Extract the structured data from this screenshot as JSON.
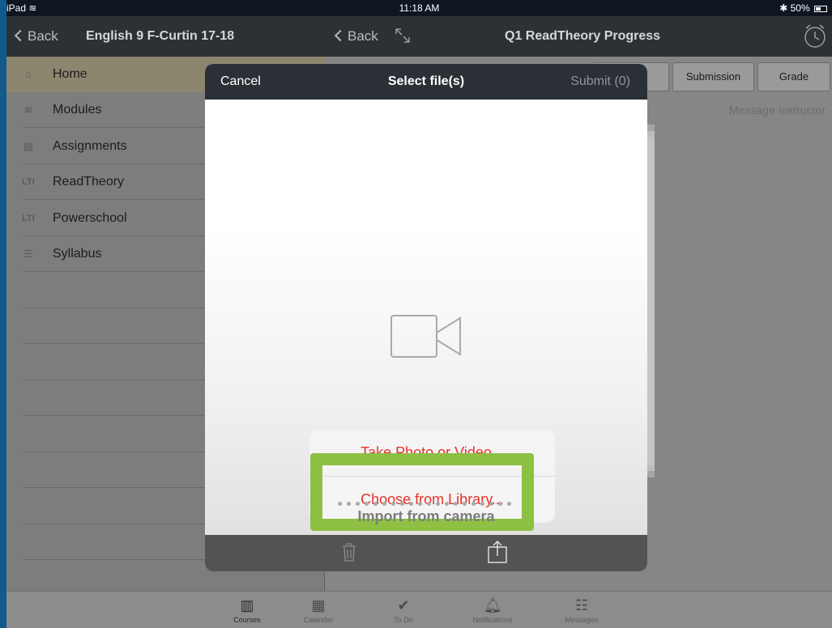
{
  "status_bar": {
    "device": "iPad",
    "time": "11:18 AM",
    "battery": "50%"
  },
  "nav_left": {
    "back_label": "Back",
    "title": "English 9 F-Curtin 17-18"
  },
  "nav_right": {
    "back_label": "Back",
    "title": "Q1 ReadTheory Progress"
  },
  "sidebar": {
    "items": [
      {
        "label": "Home",
        "icon": "home-icon",
        "active": true
      },
      {
        "label": "Modules",
        "icon": "modules-icon"
      },
      {
        "label": "Assignments",
        "icon": "assignments-icon"
      },
      {
        "label": "ReadTheory",
        "icon": "lti-icon"
      },
      {
        "label": "Powerschool",
        "icon": "lti-icon"
      },
      {
        "label": "Syllabus",
        "icon": "syllabus-icon"
      }
    ]
  },
  "content": {
    "tabs": [
      "Submission",
      "Grade"
    ],
    "message_instructor": "Message Instructor"
  },
  "modal": {
    "cancel_label": "Cancel",
    "title": "Select file(s)",
    "submit_label": "Submit (0)",
    "actions": [
      "Take Photo or Video...",
      "Choose from Library..."
    ],
    "import_label": "Import from camera",
    "highlight_color": "#8dc043"
  },
  "tabbar": {
    "items": [
      {
        "label": "Courses",
        "icon": "courses-icon"
      },
      {
        "label": "Calendar",
        "icon": "calendar-icon"
      },
      {
        "label": "To Do",
        "icon": "checkmark-icon"
      },
      {
        "label": "Notifications",
        "icon": "bell-icon"
      },
      {
        "label": "Messages",
        "icon": "inbox-icon"
      }
    ]
  }
}
